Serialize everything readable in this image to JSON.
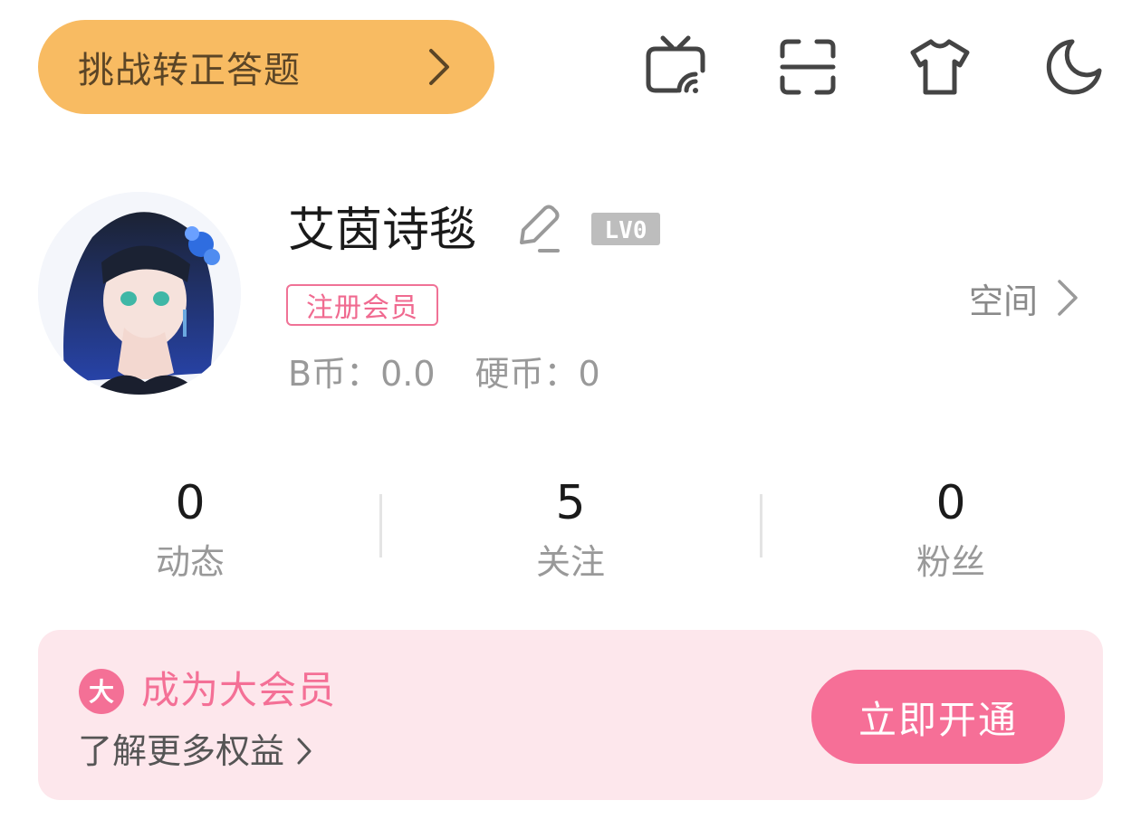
{
  "header": {
    "challenge_label": "挑战转正答题",
    "icons": [
      "tv-cast-icon",
      "scan-icon",
      "tshirt-icon",
      "moon-icon"
    ]
  },
  "profile": {
    "username": "艾茵诗毯",
    "level": "LV0",
    "member_badge": "注册会员",
    "space_label": "空间",
    "bcoin": "B币：0.0",
    "coins": "硬币：0"
  },
  "stats": [
    {
      "value": "0",
      "label": "动态"
    },
    {
      "value": "5",
      "label": "关注"
    },
    {
      "value": "0",
      "label": "粉丝"
    }
  ],
  "vip": {
    "badge_char": "大",
    "title": "成为大会员",
    "subtitle": "了解更多权益",
    "button_label": "立即开通"
  },
  "colors": {
    "challenge_bg": "#f8bb62",
    "accent_pink": "#f66f97",
    "vip_card_bg": "#fde7ec"
  }
}
